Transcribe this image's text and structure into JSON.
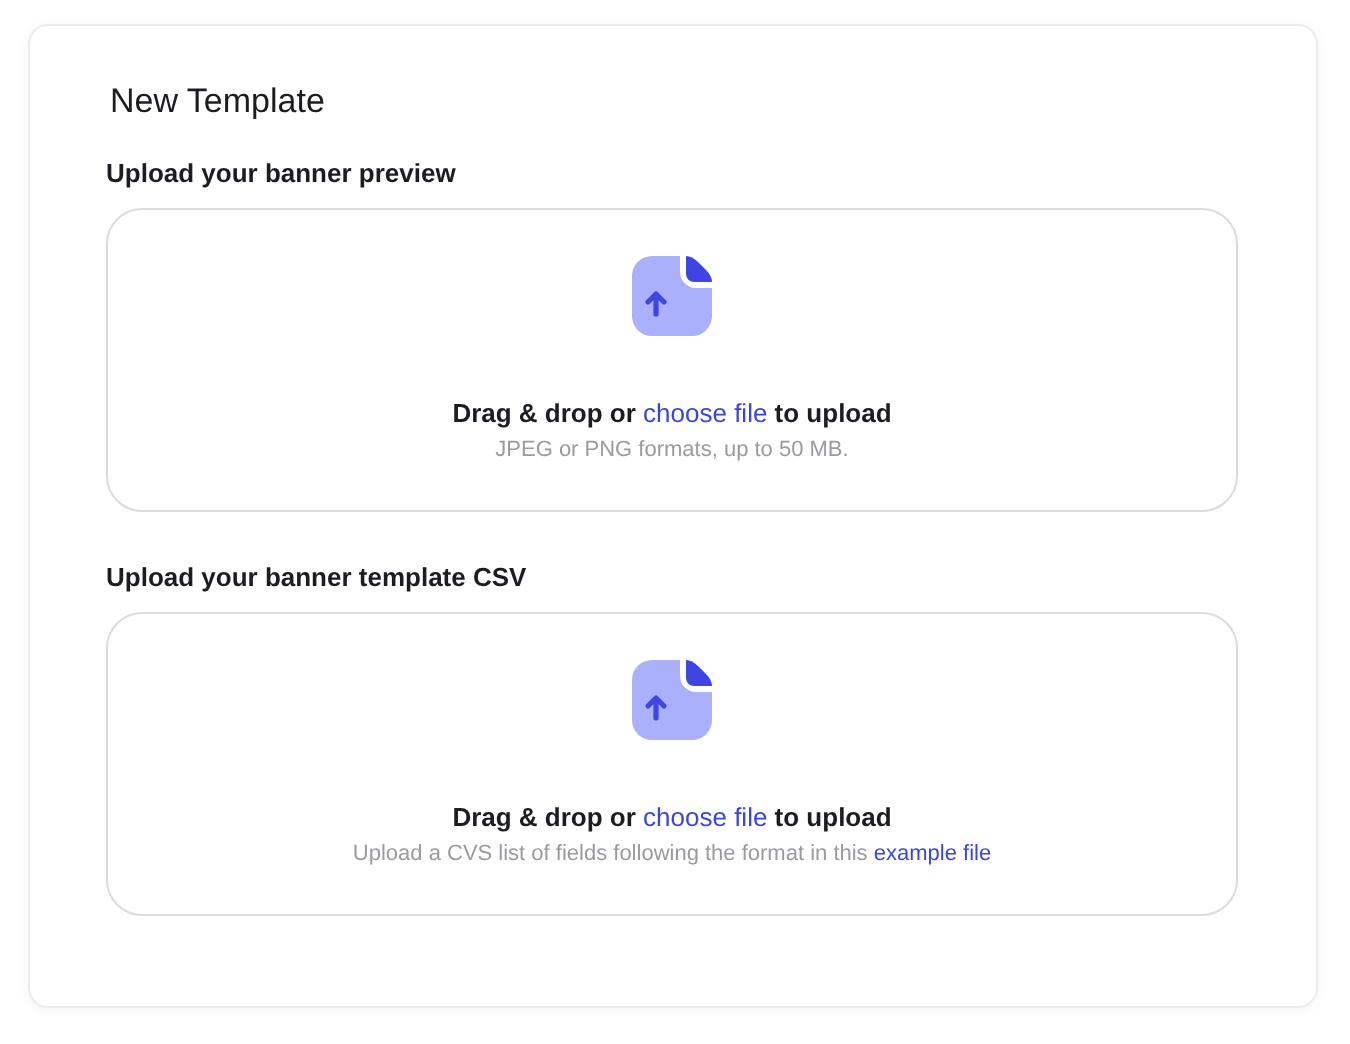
{
  "title": "New Template",
  "uploads": [
    {
      "label": "Upload your banner preview",
      "prompt": {
        "before": "Drag & drop or",
        "link": "choose file",
        "after": "to upload"
      },
      "hint": {
        "text": "JPEG or PNG formats, up to 50 MB."
      }
    },
    {
      "label": "Upload your banner template CSV",
      "prompt": {
        "before": "Drag & drop or",
        "link": "choose file",
        "after": "to upload"
      },
      "hint": {
        "text": "Upload a CVS list of fields following the format in this",
        "link": "example file"
      }
    }
  ]
}
